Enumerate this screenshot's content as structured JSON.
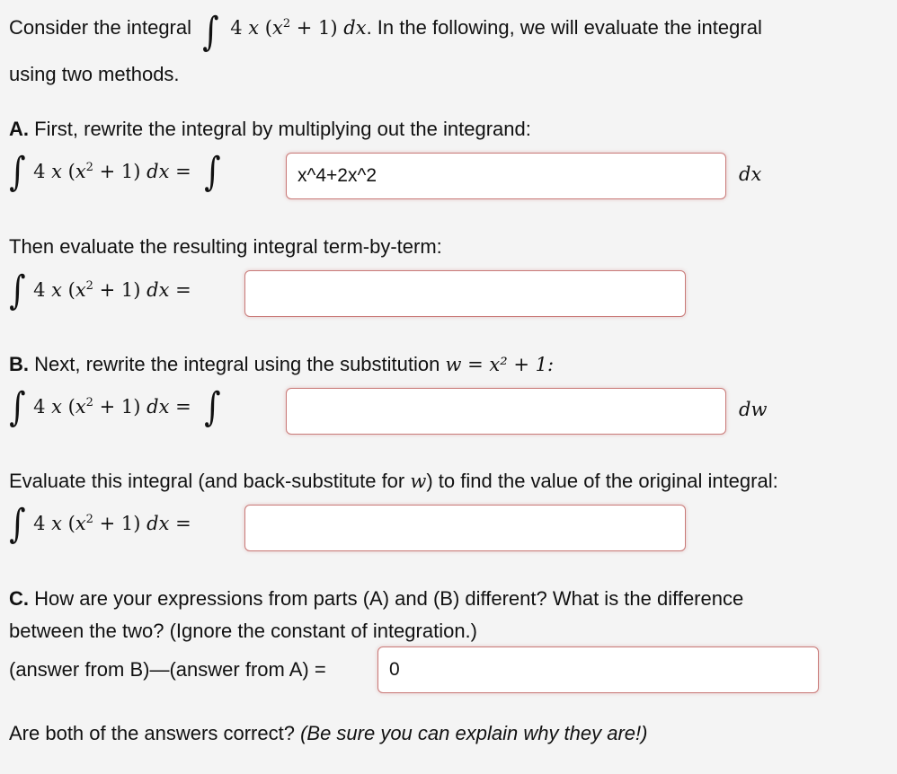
{
  "intro": {
    "prefix": "Consider the integral",
    "integrand": "4 x (x² + 1) dx",
    "suffix": ". In the following, we will evaluate the integral",
    "line2": "using two methods."
  },
  "expr": {
    "integrand_lhs": "4x(x²+1) dx",
    "equals": "=",
    "dx": "dx",
    "dw": "dw"
  },
  "partA": {
    "label": "A.",
    "text": "First, rewrite the integral by multiplying out the integrand:",
    "rewrite_value": "x^4+2x^2",
    "then_text": "Then evaluate the resulting integral term-by-term:",
    "evaluate_value": ""
  },
  "partB": {
    "label": "B.",
    "text": "Next, rewrite the integral using the substitution",
    "substitution": "w = x² + 1:",
    "rewrite_value": "",
    "evaluate_text_1": "Evaluate this integral (and back-substitute for",
    "evaluate_var": "w",
    "evaluate_text_2": ") to find the value of the original integral:",
    "evaluate_value": ""
  },
  "partC": {
    "label": "C.",
    "line1": "How are your expressions from parts (A) and (B) different? What is the difference",
    "line2": "between the two? (Ignore the constant of integration.)",
    "diff_label": "(answer from B)—(answer from A) =",
    "diff_value": "0"
  },
  "final": {
    "question": "Are both of the answers correct?",
    "note": "(Be sure you can explain why they are!)"
  }
}
